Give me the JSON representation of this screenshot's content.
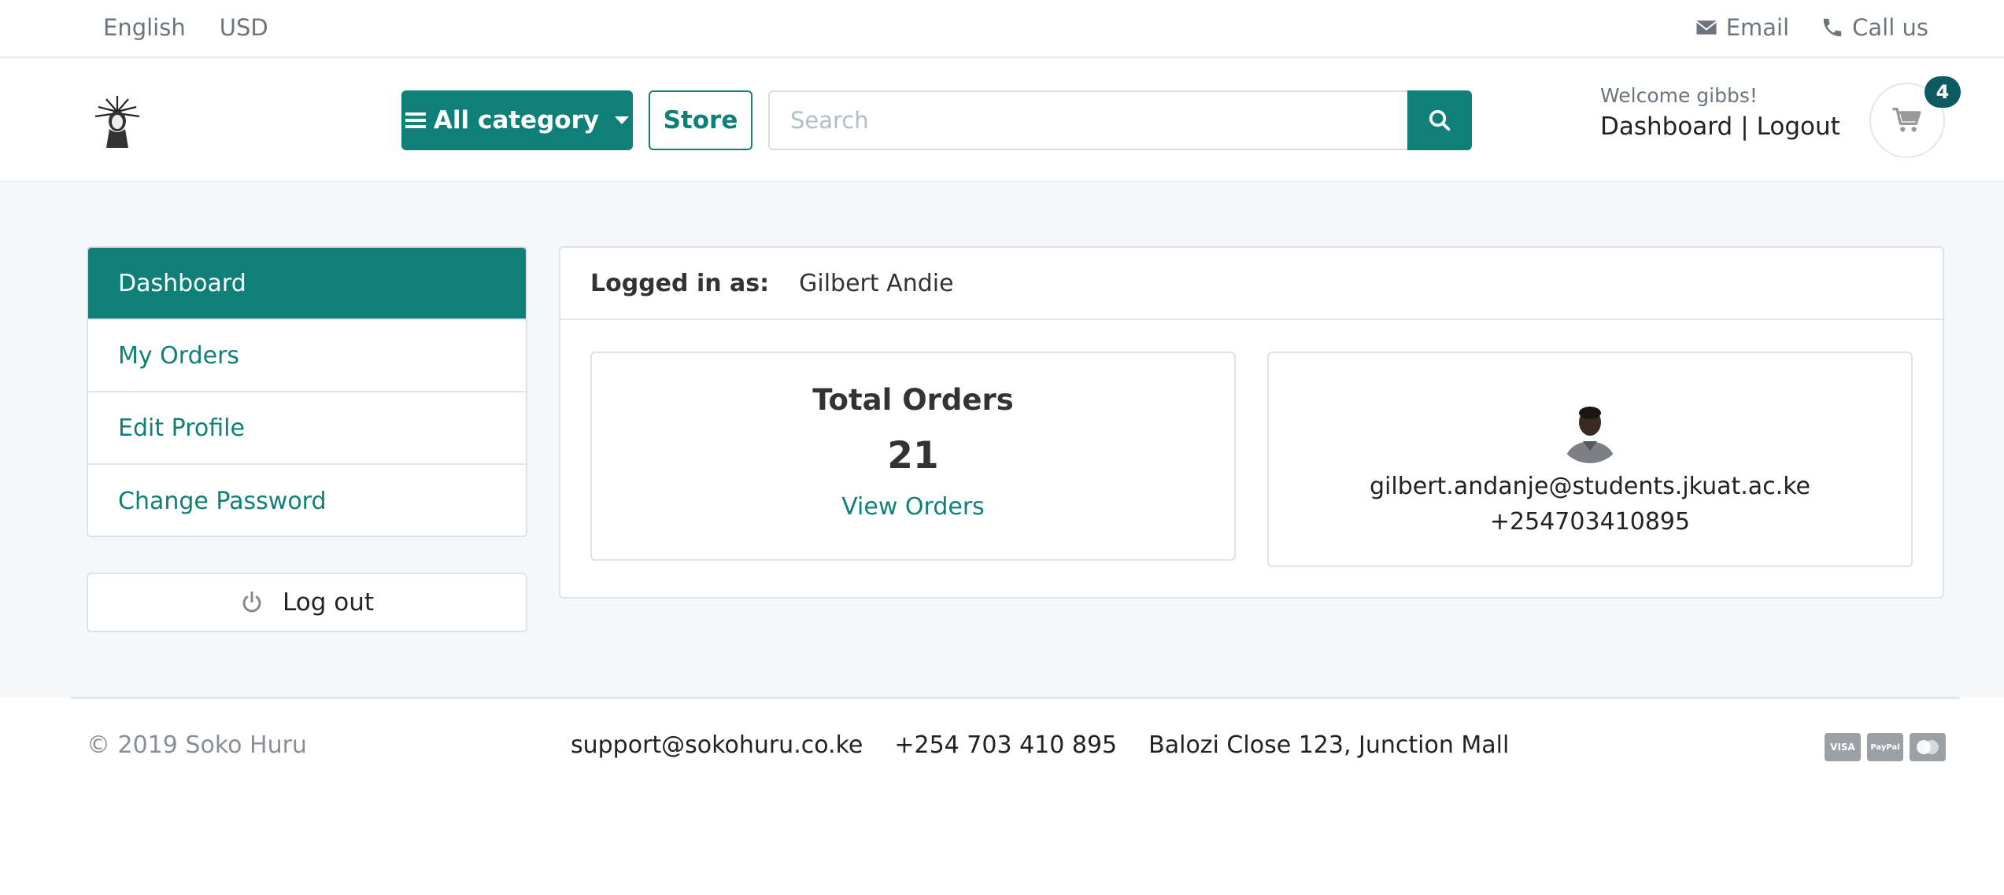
{
  "topbar": {
    "language": "English",
    "currency": "USD",
    "email_label": "Email",
    "call_label": "Call us"
  },
  "header": {
    "category_label": "All category",
    "store_label": "Store",
    "search_placeholder": "Search",
    "welcome": "Welcome gibbs!",
    "dashboard_link": "Dashboard",
    "separator": "|",
    "logout_link": "Logout",
    "cart_count": "4"
  },
  "sidebar": {
    "items": [
      {
        "label": "Dashboard"
      },
      {
        "label": "My Orders"
      },
      {
        "label": "Edit Profile"
      },
      {
        "label": "Change Password"
      }
    ],
    "logout_label": "Log out"
  },
  "panel": {
    "logged_in_label": "Logged in as:",
    "logged_in_name": "Gilbert Andie",
    "orders_title": "Total Orders",
    "orders_count": "21",
    "view_orders": "View Orders",
    "email": "gilbert.andanje@students.jkuat.ac.ke",
    "phone": "+254703410895"
  },
  "footer": {
    "copyright": "© 2019 Soko Huru",
    "support_email": "support@sokohuru.co.ke",
    "support_phone": "+254 703 410 895",
    "address": "Balozi Close 123, Junction Mall",
    "payments": [
      "VISA",
      "PayPal",
      "MC"
    ]
  },
  "colors": {
    "primary": "#0f8077",
    "badge": "#0d5a63",
    "muted": "#6c757d",
    "background": "#f6f7f9"
  }
}
